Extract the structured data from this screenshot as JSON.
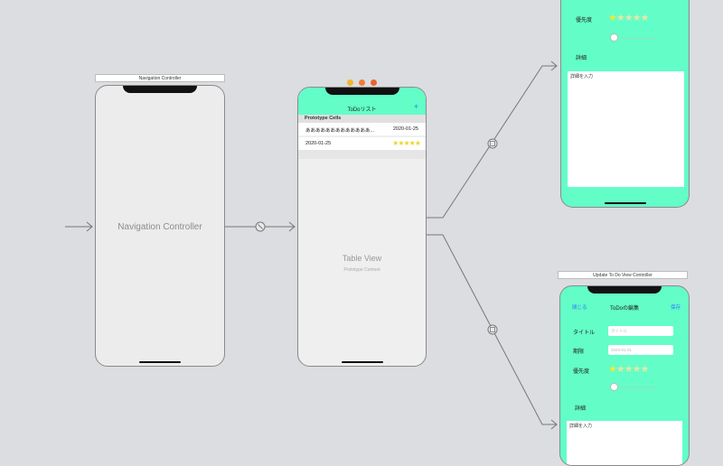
{
  "nav_controller": {
    "label": "Navigation Controller",
    "title": "Navigation Controller"
  },
  "table_controller": {
    "nav_title": "ToDoリスト",
    "add_icon": "+",
    "section_header": "Prototype Cells",
    "cell1_left": "あああああああああああああ...",
    "cell1_right": "2020-01-25",
    "cell2_left": "2020-01-25",
    "cell2_stars": "★★★★★",
    "table_view_title": "Table View",
    "table_view_subtitle": "Prototype Content"
  },
  "top_detail": {
    "priority_label": "優先度",
    "details_label": "詳細",
    "details_placeholder": "詳細を入力",
    "priority_value": 1,
    "priority_max": 5
  },
  "update_controller": {
    "label": "Update To Do View Controller",
    "close": "閉じる",
    "nav_title": "ToDoの編集",
    "save": "保存",
    "title_label": "タイトル",
    "title_placeholder": "タイトル",
    "deadline_label": "期限",
    "deadline_placeholder": "2020-01-01",
    "priority_label": "優先度",
    "details_label": "詳細",
    "details_placeholder": "詳細を入力",
    "priority_value": 1,
    "priority_max": 5
  },
  "colors": {
    "mint": "#63fdc8",
    "canvas": "#dcdde0",
    "link": "#2a7cf6",
    "star": "#f3ea2c"
  },
  "icons": {
    "scene_dock": [
      "view-controller-icon",
      "first-responder-icon",
      "exit-icon"
    ],
    "segue_relationship": "relationship-segue-icon",
    "segue_show": "show-segue-icon"
  }
}
